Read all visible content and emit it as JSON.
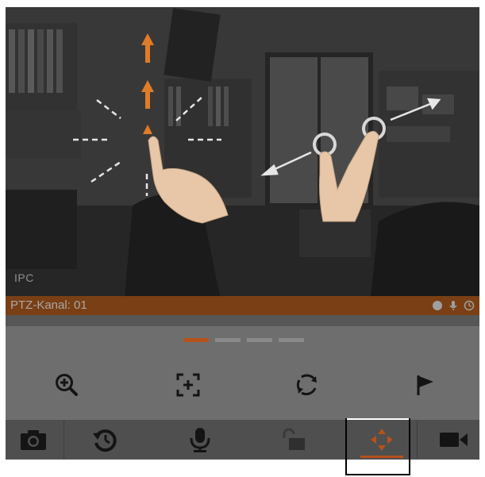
{
  "video": {
    "camera_label": "IPC",
    "gesture_hint": "pan-and-pinch-zoom-gesture"
  },
  "status_bar": {
    "channel_label": "PTZ-Kanal: 01",
    "icons": [
      "record-dot-icon",
      "mic-small-icon",
      "clock-icon"
    ]
  },
  "pager": {
    "pages": 4,
    "active_index": 0
  },
  "ptz_controls": [
    {
      "name": "zoom-in-icon"
    },
    {
      "name": "focus-frame-icon"
    },
    {
      "name": "auto-rotate-icon"
    },
    {
      "name": "preset-flag-icon"
    }
  ],
  "toolbar": {
    "items": [
      {
        "name": "snapshot-camera-icon",
        "selected": false
      },
      {
        "name": "playback-history-icon",
        "selected": false
      },
      {
        "name": "microphone-icon",
        "selected": false
      },
      {
        "name": "unlock-icon",
        "selected": false
      },
      {
        "name": "ptz-direction-icon",
        "selected": true
      },
      {
        "name": "record-video-icon",
        "selected": false
      }
    ]
  },
  "colors": {
    "accent": "#b5521b",
    "icon": "#141414",
    "panel_bg": "#6e6e6e",
    "toolbar_bg": "#4f4f4f"
  }
}
